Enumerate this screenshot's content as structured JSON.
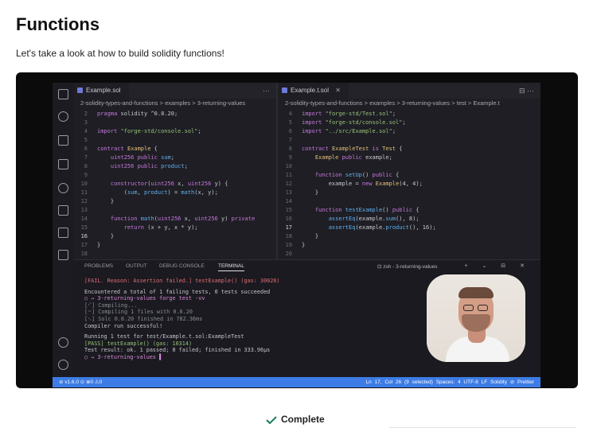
{
  "page": {
    "title": "Functions",
    "subtitle": "Let's take a look at how to build solidity functions!"
  },
  "editor": {
    "left_tab": {
      "label": "Example.sol",
      "close": "",
      "actions": "···"
    },
    "right_tab": {
      "label": "Example.t.sol",
      "close": "✕",
      "actions": "⊟  ···"
    },
    "left_breadcrumb": "2-solidity-types-and-functions > examples > 3-returning-values",
    "right_breadcrumb": "2-solidity-types-and-functions > examples > 3-returning-values > test > Example.t",
    "left_code": [
      {
        "n": "2",
        "t": "pragma solidity ^0.8.20;"
      },
      {
        "n": "3",
        "t": ""
      },
      {
        "n": "4",
        "t": "import \"forge-std/console.sol\";"
      },
      {
        "n": "5",
        "t": ""
      },
      {
        "n": "6",
        "t": "contract Example {"
      },
      {
        "n": "7",
        "t": "    uint256 public sum;"
      },
      {
        "n": "8",
        "t": "    uint256 public product;"
      },
      {
        "n": "9",
        "t": ""
      },
      {
        "n": "10",
        "t": "    constructor(uint256 x, uint256 y) {"
      },
      {
        "n": "11",
        "t": "        (sum, product) = math(x, y);"
      },
      {
        "n": "12",
        "t": "    }"
      },
      {
        "n": "13",
        "t": ""
      },
      {
        "n": "14",
        "t": "    function math(uint256 x, uint256 y) private"
      },
      {
        "n": "15",
        "t": "        return (x + y, x * y);"
      },
      {
        "n": "16",
        "t": "    }"
      },
      {
        "n": "17",
        "t": "}"
      },
      {
        "n": "18",
        "t": ""
      }
    ],
    "right_code": [
      {
        "n": "4",
        "t": "import \"forge-std/Test.sol\";"
      },
      {
        "n": "5",
        "t": "import \"forge-std/console.sol\";"
      },
      {
        "n": "6",
        "t": "import \"../src/Example.sol\";"
      },
      {
        "n": "7",
        "t": ""
      },
      {
        "n": "8",
        "t": "contract ExampleTest is Test {"
      },
      {
        "n": "9",
        "t": "    Example public example;"
      },
      {
        "n": "10",
        "t": ""
      },
      {
        "n": "11",
        "t": "    function setUp() public {"
      },
      {
        "n": "12",
        "t": "        example = new Example(4, 4);"
      },
      {
        "n": "13",
        "t": "    }"
      },
      {
        "n": "14",
        "t": ""
      },
      {
        "n": "15",
        "t": "    function testExample() public {"
      },
      {
        "n": "16",
        "t": "        assertEq(example.sum(), 8);"
      },
      {
        "n": "17",
        "t": "        assertEq(example.product(), 16);"
      },
      {
        "n": "18",
        "t": "    }"
      },
      {
        "n": "19",
        "t": "}"
      },
      {
        "n": "20",
        "t": ""
      }
    ]
  },
  "panel": {
    "tabs": [
      "PROBLEMS",
      "OUTPUT",
      "DEBUG CONSOLE",
      "TERMINAL"
    ],
    "terminal_label": "⊡ zsh - 3-returning-values",
    "actions": "+ ⌄ ⊟ ✕",
    "lines": [
      "[FAIL. Reason: Assertion failed.] testExample() (gas: 30026)",
      "",
      "Encountered a total of 1 failing tests, 0 tests succeeded",
      "○ → 3-returning-values forge test -vv",
      "[⠊] Compiling...",
      "[⠒] Compiling 1 files with 0.8.20",
      "[⠢] Solc 0.8.20 finished in 782.36ms",
      "Compiler run successful!",
      "",
      "Running 1 test for test/Example.t.sol:ExampleTest",
      "[PASS] testExample() (gas: 10314)",
      "Test result: ok. 1 passed; 0 failed; finished in 333.96µs",
      "○ → 3-returning-values ▌"
    ]
  },
  "statusbar": {
    "left": "⊘ v1.6.0 ⊙   ⊗0 ⚠0",
    "right": "Ln 17, Col 26 (9 selected)   Spaces: 4   UTF-8   LF   Solidity   ⊘ Prettier"
  },
  "actions": {
    "complete_label": "Complete"
  },
  "colors": {
    "accent_green": "#1a7f5a",
    "statusbar_blue": "#3d7ce6"
  }
}
